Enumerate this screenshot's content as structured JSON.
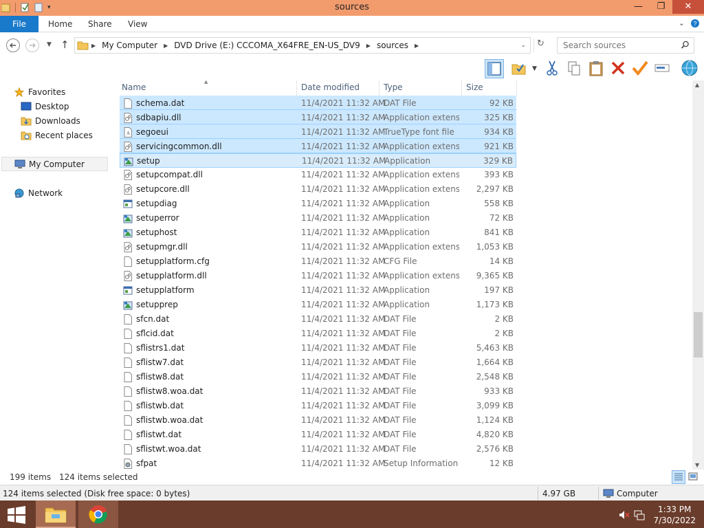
{
  "window": {
    "title": "sources",
    "controls": {
      "minimize": "—",
      "maximize": "❐",
      "close": "✕"
    }
  },
  "ribbon": {
    "tabs": [
      "File",
      "Home",
      "Share",
      "View"
    ]
  },
  "address": {
    "crumbs": [
      "My Computer",
      "DVD Drive (E:) CCCOMA_X64FRE_EN-US_DV9",
      "sources"
    ],
    "search_placeholder": "Search sources"
  },
  "nav": {
    "favorites": "Favorites",
    "desktop": "Desktop",
    "downloads": "Downloads",
    "recent": "Recent places",
    "computer": "My Computer",
    "network": "Network"
  },
  "columns": {
    "name": "Name",
    "date": "Date modified",
    "type": "Type",
    "size": "Size"
  },
  "files": [
    {
      "name": "schema.dat",
      "date": "11/4/2021 11:32 AM",
      "type": "DAT File",
      "size": "92 KB",
      "icon": "generic-file-icon",
      "selected": true
    },
    {
      "name": "sdbapiu.dll",
      "date": "11/4/2021 11:32 AM",
      "type": "Application extens...",
      "size": "325 KB",
      "icon": "dll-file-icon",
      "selected": true
    },
    {
      "name": "segoeui",
      "date": "11/4/2021 11:32 AM",
      "type": "TrueType font file",
      "size": "934 KB",
      "icon": "font-file-icon",
      "selected": true
    },
    {
      "name": "servicingcommon.dll",
      "date": "11/4/2021 11:32 AM",
      "type": "Application extens...",
      "size": "921 KB",
      "icon": "dll-file-icon",
      "selected": true
    },
    {
      "name": "setup",
      "date": "11/4/2021 11:32 AM",
      "type": "Application",
      "size": "329 KB",
      "icon": "setup-app-icon",
      "selected": true
    },
    {
      "name": "setupcompat.dll",
      "date": "11/4/2021 11:32 AM",
      "type": "Application extens...",
      "size": "393 KB",
      "icon": "dll-file-icon",
      "selected": false
    },
    {
      "name": "setupcore.dll",
      "date": "11/4/2021 11:32 AM",
      "type": "Application extens...",
      "size": "2,297 KB",
      "icon": "dll-file-icon",
      "selected": false
    },
    {
      "name": "setupdiag",
      "date": "11/4/2021 11:32 AM",
      "type": "Application",
      "size": "558 KB",
      "icon": "app-window-icon",
      "selected": false
    },
    {
      "name": "setuperror",
      "date": "11/4/2021 11:32 AM",
      "type": "Application",
      "size": "72 KB",
      "icon": "setup-app-icon",
      "selected": false
    },
    {
      "name": "setuphost",
      "date": "11/4/2021 11:32 AM",
      "type": "Application",
      "size": "841 KB",
      "icon": "setup-app-icon",
      "selected": false
    },
    {
      "name": "setupmgr.dll",
      "date": "11/4/2021 11:32 AM",
      "type": "Application extens...",
      "size": "1,053 KB",
      "icon": "dll-file-icon",
      "selected": false
    },
    {
      "name": "setupplatform.cfg",
      "date": "11/4/2021 11:32 AM",
      "type": "CFG File",
      "size": "14 KB",
      "icon": "generic-file-icon",
      "selected": false
    },
    {
      "name": "setupplatform.dll",
      "date": "11/4/2021 11:32 AM",
      "type": "Application extens...",
      "size": "9,365 KB",
      "icon": "dll-file-icon",
      "selected": false
    },
    {
      "name": "setupplatform",
      "date": "11/4/2021 11:32 AM",
      "type": "Application",
      "size": "197 KB",
      "icon": "app-window-icon",
      "selected": false
    },
    {
      "name": "setupprep",
      "date": "11/4/2021 11:32 AM",
      "type": "Application",
      "size": "1,173 KB",
      "icon": "setup-app-icon",
      "selected": false
    },
    {
      "name": "sfcn.dat",
      "date": "11/4/2021 11:32 AM",
      "type": "DAT File",
      "size": "2 KB",
      "icon": "generic-file-icon",
      "selected": false
    },
    {
      "name": "sflcid.dat",
      "date": "11/4/2021 11:32 AM",
      "type": "DAT File",
      "size": "2 KB",
      "icon": "generic-file-icon",
      "selected": false
    },
    {
      "name": "sflistrs1.dat",
      "date": "11/4/2021 11:32 AM",
      "type": "DAT File",
      "size": "5,463 KB",
      "icon": "generic-file-icon",
      "selected": false
    },
    {
      "name": "sflistw7.dat",
      "date": "11/4/2021 11:32 AM",
      "type": "DAT File",
      "size": "1,664 KB",
      "icon": "generic-file-icon",
      "selected": false
    },
    {
      "name": "sflistw8.dat",
      "date": "11/4/2021 11:32 AM",
      "type": "DAT File",
      "size": "2,548 KB",
      "icon": "generic-file-icon",
      "selected": false
    },
    {
      "name": "sflistw8.woa.dat",
      "date": "11/4/2021 11:32 AM",
      "type": "DAT File",
      "size": "933 KB",
      "icon": "generic-file-icon",
      "selected": false
    },
    {
      "name": "sflistwb.dat",
      "date": "11/4/2021 11:32 AM",
      "type": "DAT File",
      "size": "3,099 KB",
      "icon": "generic-file-icon",
      "selected": false
    },
    {
      "name": "sflistwb.woa.dat",
      "date": "11/4/2021 11:32 AM",
      "type": "DAT File",
      "size": "1,124 KB",
      "icon": "generic-file-icon",
      "selected": false
    },
    {
      "name": "sflistwt.dat",
      "date": "11/4/2021 11:32 AM",
      "type": "DAT File",
      "size": "4,820 KB",
      "icon": "generic-file-icon",
      "selected": false
    },
    {
      "name": "sflistwt.woa.dat",
      "date": "11/4/2021 11:32 AM",
      "type": "DAT File",
      "size": "2,576 KB",
      "icon": "generic-file-icon",
      "selected": false
    },
    {
      "name": "sfpat",
      "date": "11/4/2021 11:32 AM",
      "type": "Setup Information",
      "size": "12 KB",
      "icon": "setup-info-icon",
      "selected": false
    }
  ],
  "status": {
    "count": "199 items",
    "selected": "124 items selected"
  },
  "details": {
    "text": "124 items selected (Disk free space: 0 bytes)",
    "size": "4.97 GB",
    "location": "Computer"
  },
  "taskbar": {
    "time": "1:33 PM",
    "date": "7/30/2022"
  },
  "colors": {
    "titlebar": "#f29b6d",
    "file_tab": "#1979ca",
    "selection": "#cce8ff",
    "taskbar": "#6a3c2b"
  }
}
